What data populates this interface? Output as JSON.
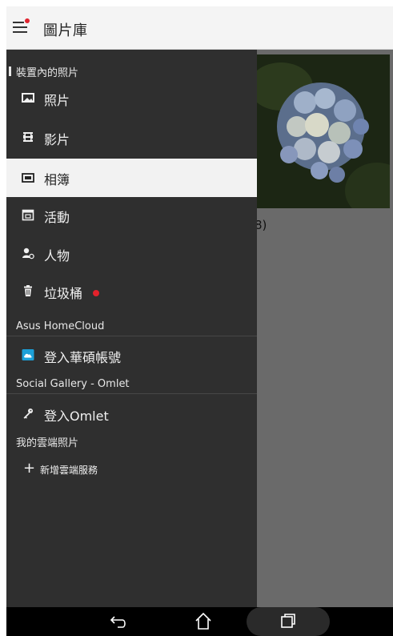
{
  "app": {
    "title": "圖片庫"
  },
  "drawer": {
    "sections": {
      "device": "裝置內的照片",
      "homecloud": "Asus HomeCloud",
      "social": "Social Gallery - Omlet",
      "cloud": "我的雲端照片"
    },
    "items": {
      "photos": "照片",
      "videos": "影片",
      "albums": "相簿",
      "events": "活動",
      "people": "人物",
      "trash": "垃圾桶",
      "asus_login": "登入華碩帳號",
      "omlet_login": "登入Omlet",
      "add_cloud": "新增雲端服務"
    },
    "selected_item": "albums"
  },
  "background": {
    "album_count": "8)"
  },
  "icons": {
    "menu": "hamburger-menu-icon",
    "photos": "photo-icon",
    "videos": "film-icon",
    "albums": "album-icon",
    "events": "calendar-icon",
    "people": "person-icon",
    "trash": "trash-icon",
    "asus": "cloud-icon",
    "omlet": "key-icon",
    "add": "plus-icon",
    "back": "back-icon",
    "home": "home-icon",
    "recents": "recents-icon"
  },
  "colors": {
    "drawer_bg": "#2f2f2f",
    "selected_bg": "#f2f2f2",
    "notification_red": "#e3222b",
    "asus_icon_blue": "#1ca0d8"
  }
}
